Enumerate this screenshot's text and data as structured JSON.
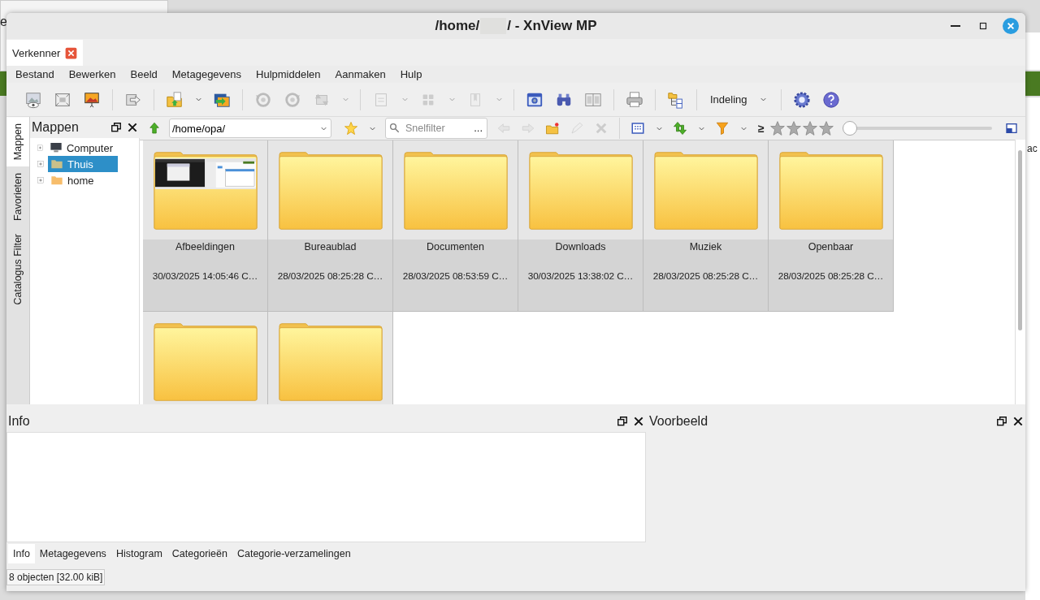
{
  "desktop": {
    "texts": [
      "e",
      "ac"
    ]
  },
  "window": {
    "title_start": "/home/",
    "title_end": "/ - XnView MP"
  },
  "document_tabs": [
    {
      "label": "Verkenner",
      "selected": true
    }
  ],
  "menu": [
    "Bestand",
    "Bewerken",
    "Beeld",
    "Metagegevens",
    "Hulpmiddelen",
    "Aanmaken",
    "Hulp"
  ],
  "toolbar": [
    {
      "kind": "button",
      "disabled": false
    },
    {
      "kind": "button",
      "disabled": false
    },
    {
      "kind": "button",
      "disabled": false
    },
    {
      "kind": "separator"
    },
    {
      "kind": "button",
      "disabled": false
    },
    {
      "kind": "separator"
    },
    {
      "kind": "split",
      "disabled": false
    },
    {
      "kind": "button",
      "disabled": false
    },
    {
      "kind": "separator"
    },
    {
      "kind": "button",
      "disabled": true
    },
    {
      "kind": "button",
      "disabled": true
    },
    {
      "kind": "split",
      "disabled": true
    },
    {
      "kind": "separator"
    },
    {
      "kind": "split",
      "disabled": true
    },
    {
      "kind": "split",
      "disabled": true
    },
    {
      "kind": "split",
      "disabled": true
    },
    {
      "kind": "separator"
    },
    {
      "kind": "button",
      "disabled": false
    },
    {
      "kind": "button",
      "disabled": false
    },
    {
      "kind": "button",
      "disabled": false
    },
    {
      "kind": "separator"
    },
    {
      "kind": "button",
      "disabled": false
    },
    {
      "kind": "separator"
    },
    {
      "kind": "button",
      "disabled": false
    },
    {
      "kind": "separator"
    },
    {
      "kind": "menu",
      "label": "Indeling"
    },
    {
      "kind": "separator"
    },
    {
      "kind": "button",
      "disabled": false
    },
    {
      "kind": "button",
      "disabled": false
    }
  ],
  "side_tabs": [
    {
      "label": "Mappen",
      "selected": true
    },
    {
      "label": "Favorieten",
      "selected": false
    },
    {
      "label": "Catalogus Filter",
      "selected": false
    }
  ],
  "folders_panel": {
    "title": "Mappen",
    "tree": [
      {
        "label": "Computer",
        "kind": "computer",
        "selected": false
      },
      {
        "label": "Thuis",
        "kind": "home",
        "selected": true
      },
      {
        "label": "home",
        "kind": "folder",
        "selected": false
      }
    ]
  },
  "address_bar": {
    "path": "/home/opa/",
    "filter_placeholder": "Snelfilter",
    "filter_button": "...",
    "rating_operator": "≥",
    "zoom": {
      "level": 0.0
    },
    "nav_buttons": [
      {
        "disabled": true
      },
      {
        "disabled": true
      },
      {
        "disabled": false
      },
      {
        "disabled": true
      },
      {
        "disabled": true
      }
    ]
  },
  "thumbnails": [
    {
      "kind": "preview",
      "name": "Afbeeldingen",
      "date": "30/03/2025 14:05:46 C…"
    },
    {
      "kind": "folder",
      "name": "Bureaublad",
      "date": "28/03/2025 08:25:28 C…"
    },
    {
      "kind": "folder",
      "name": "Documenten",
      "date": "28/03/2025 08:53:59 C…"
    },
    {
      "kind": "folder",
      "name": "Downloads",
      "date": "30/03/2025 13:38:02 C…"
    },
    {
      "kind": "folder",
      "name": "Muziek",
      "date": "28/03/2025 08:25:28 C…"
    },
    {
      "kind": "folder",
      "name": "Openbaar",
      "date": "28/03/2025 08:25:28 C…"
    },
    {
      "kind": "folder"
    },
    {
      "kind": "folder"
    }
  ],
  "info_panel": {
    "title": "Info",
    "tabs": [
      {
        "label": "Info",
        "selected": true
      },
      {
        "label": "Metagegevens",
        "selected": false
      },
      {
        "label": "Histogram",
        "selected": false
      },
      {
        "label": "Categorieën",
        "selected": false
      },
      {
        "label": "Categorie-verzamelingen",
        "selected": false
      }
    ]
  },
  "preview_panel": {
    "title": "Voorbeeld"
  },
  "status_bar": "8 objecten [32.00 kiB]"
}
